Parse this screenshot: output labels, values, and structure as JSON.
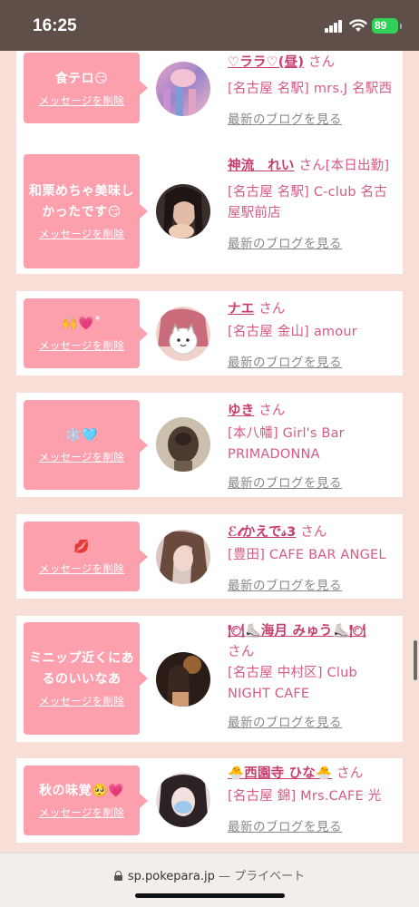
{
  "status_bar": {
    "time": "16:25",
    "battery": "89"
  },
  "entries": [
    {
      "message": "食テロ😏",
      "delete_label": "メッセージを削除",
      "name": "♡ララ♡(昼)",
      "honorific": "さん",
      "location": "[名古屋 名駅] mrs.J 名駅西",
      "blog_link": "最新のブログを見る",
      "avatar": "pink-hair-photo"
    },
    {
      "message": "和栗めちゃ美味しかったです😏",
      "delete_label": "メッセージを削除",
      "name": "神流　れい",
      "honorific": "さん",
      "location": "[本日出勤]",
      "location2": "[名古屋 名駅] C-club 名古屋駅前店",
      "blog_link": "最新のブログを見る",
      "avatar": "dark-hair-photo"
    },
    {
      "message": "🙌💗˚",
      "delete_label": "メッセージを削除",
      "name": "ナエ",
      "honorific": "さん",
      "location": "[名古屋 金山] amour",
      "blog_link": "最新のブログを見る",
      "avatar": "cat-sticker-photo"
    },
    {
      "message": "❄️🩵",
      "delete_label": "メッセージを削除",
      "name": "ゆき",
      "honorific": "さん",
      "location": "[本八幡] Girl's Bar PRIMADONNA",
      "blog_link": "最新のブログを見る",
      "avatar": "hair-back-photo"
    },
    {
      "message": "💋",
      "delete_label": "メッセージを削除",
      "name": "ℰ𝓉かえで𝓈3",
      "honorific": "さん",
      "location": "[豊田] CAFE BAR ANGEL",
      "blog_link": "最新のブログを見る",
      "avatar": "blurred-portrait-photo"
    },
    {
      "message": "ミニップ近くにあるのいいなあ",
      "delete_label": "メッセージを削除",
      "name": "🍽⛸️海月 みゅう⛸️🍽",
      "honorific": "さん",
      "location": "[名古屋 中村区] Club NIGHT CAFE",
      "blog_link": "最新のブログを見る",
      "avatar": "warm-light-photo"
    },
    {
      "message": "秋の味覚🥺💗",
      "delete_label": "メッセージを削除",
      "name": "🐣西園寺 ひな🐣",
      "honorific": "さん",
      "location": "[名古屋 錦] Mrs.CAFE 光",
      "blog_link": "最新のブログを見る",
      "avatar": "mask-blur-photo"
    }
  ],
  "browser": {
    "url": "sp.pokepara.jp",
    "separator": "—",
    "mode": "プライベート"
  }
}
